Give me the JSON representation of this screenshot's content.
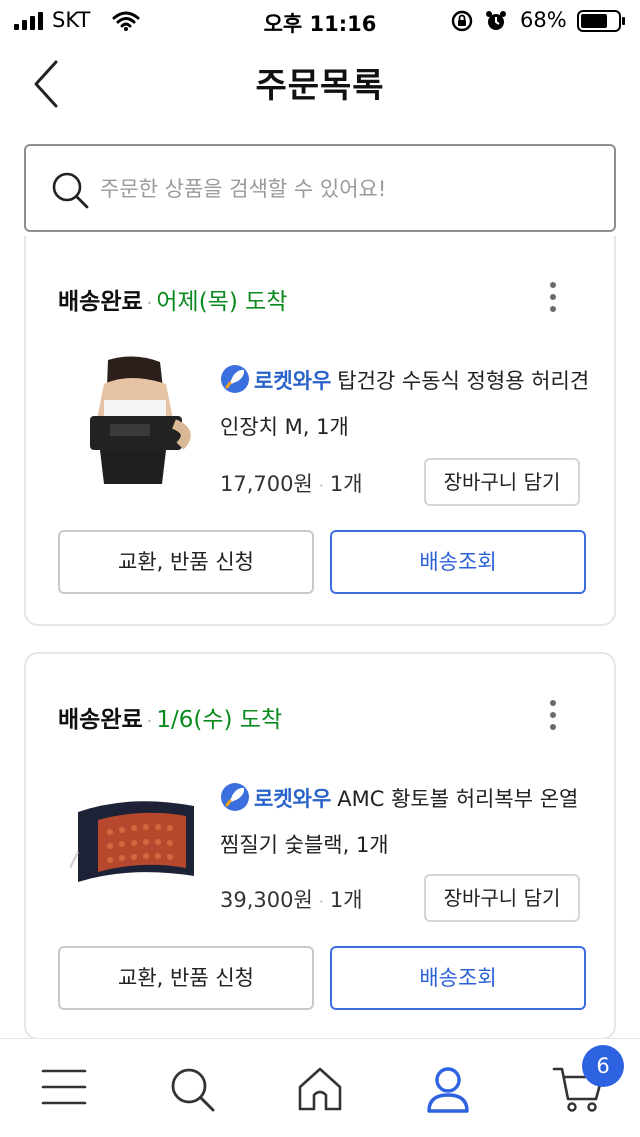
{
  "status_bar": {
    "carrier": "SKT",
    "time": "오후 11:16",
    "battery": "68%"
  },
  "header": {
    "title": "주문목록"
  },
  "search": {
    "placeholder": "주문한 상품을 검색할 수 있어요!"
  },
  "orders": [
    {
      "status": "배송완료",
      "arrival": "어제(목) 도착",
      "badge": "로켓와우",
      "product_name": "탑건강 수동식 정형용 허리견인장치 M, 1개",
      "price": "17,700원",
      "qty": "1개",
      "cart_label": "장바구니 담기",
      "return_label": "교환, 반품 신청",
      "track_label": "배송조회"
    },
    {
      "status": "배송완료",
      "arrival": "1/6(수) 도착",
      "badge": "로켓와우",
      "product_name": "AMC 황토볼 허리복부 온열 찜질기 숯블랙, 1개",
      "price": "39,300원",
      "qty": "1개",
      "cart_label": "장바구니 담기",
      "return_label": "교환, 반품 신청",
      "track_label": "배송조회"
    }
  ],
  "bottom_nav": {
    "items": [
      "menu-icon",
      "search-icon",
      "home-icon",
      "my-page-icon",
      "cart-icon"
    ],
    "active": "my-page-icon",
    "cart_count": "6"
  },
  "colors": {
    "accent_blue": "#2d63e0",
    "arrival_green": "#0a8a1e",
    "rocket_blue": "#2a63c9"
  }
}
